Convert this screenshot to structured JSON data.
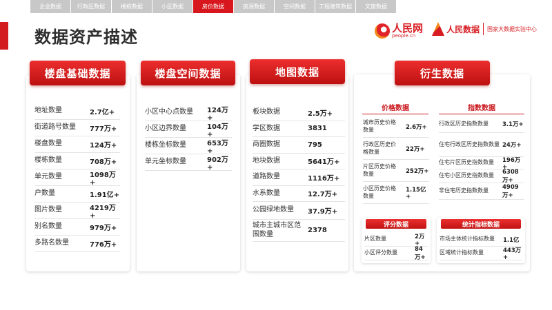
{
  "tabs": [
    "企业数据",
    "行政区数据",
    "楼栋数据",
    "小区数据",
    "房价数据",
    "房源数据",
    "空间数据",
    "工程建筑数据",
    "文旅数据"
  ],
  "active_tab": 4,
  "page_title": "数据资产描述",
  "logos": {
    "people_main": "人民网",
    "people_sub": "people.cn",
    "rmsj_main": "人民数据",
    "rmsj_badge": "数据",
    "rmsj_center": "国家大数据实验中心"
  },
  "cards": {
    "basic": {
      "title": "楼盘基础数据",
      "rows": [
        {
          "label": "地址数量",
          "value": "2.7亿+"
        },
        {
          "label": "街道路号数量",
          "value": "777万+"
        },
        {
          "label": "楼盘数量",
          "value": "124万+"
        },
        {
          "label": "楼栋数量",
          "value": "708万+"
        },
        {
          "label": "单元数量",
          "value": "1098万+"
        },
        {
          "label": "户数量",
          "value": "1.91亿+"
        },
        {
          "label": "图片数量",
          "value": "4219万+"
        },
        {
          "label": "别名数量",
          "value": "979万+"
        },
        {
          "label": "多路名数量",
          "value": "776万+"
        }
      ]
    },
    "spatial": {
      "title": "楼盘空间数据",
      "rows": [
        {
          "label": "小区中心点数量",
          "value": "124万+"
        },
        {
          "label": "小区边界数量",
          "value": "104万+"
        },
        {
          "label": "楼栋坐标数量",
          "value": "653万+"
        },
        {
          "label": "单元坐标数量",
          "value": "902万+"
        }
      ]
    },
    "map": {
      "title": "地图数据",
      "rows": [
        {
          "label": "板块数据",
          "value": "2.5万+"
        },
        {
          "label": "学区数据",
          "value": "3831"
        },
        {
          "label": "商圈数据",
          "value": "795"
        },
        {
          "label": "地块数据",
          "value": "5641万+"
        },
        {
          "label": "道路数量",
          "value": "1116万+"
        },
        {
          "label": "水系数量",
          "value": "12.7万+"
        },
        {
          "label": "公园绿地数量",
          "value": "37.9万+"
        },
        {
          "label": "城市主城市区范围数量",
          "value": "2378"
        }
      ]
    },
    "derived": {
      "title": "衍生数据",
      "price": {
        "title": "价格数据",
        "rows": [
          {
            "label": "城市历史价格数量",
            "value": "2.6万+"
          },
          {
            "label": "行政区历史价格数量",
            "value": "22万+"
          },
          {
            "label": "片区历史价格数量",
            "value": "252万+"
          },
          {
            "label": "小区历史价格数量",
            "value": "1.15亿+"
          }
        ]
      },
      "index": {
        "title": "指数数据",
        "rows": [
          {
            "label": "行政区历史指数数量",
            "value": "3.1万+"
          },
          {
            "label": "住宅行政区历史指数数量",
            "value": "24万+"
          },
          {
            "label": "住宅片区历史指数数量",
            "value": "196万+"
          },
          {
            "label": "住宅小区历史指数数量",
            "value": "6308万+"
          },
          {
            "label": "非住宅历史指数数量",
            "value": "4909万+"
          }
        ]
      },
      "rating": {
        "title": "评分数据",
        "rows": [
          {
            "label": "片区数量",
            "value": "2万+"
          },
          {
            "label": "小区评分数量",
            "value": "84万+"
          }
        ]
      },
      "stats": {
        "title": "统计指标数据",
        "rows": [
          {
            "label": "市场主体统计指标数量",
            "value": "1.1亿"
          },
          {
            "label": "区域统计指标数量",
            "value": "443万+"
          }
        ]
      }
    }
  },
  "colors": {
    "accent": "#d21a1f",
    "tab_inactive": "#c8c8c8"
  }
}
